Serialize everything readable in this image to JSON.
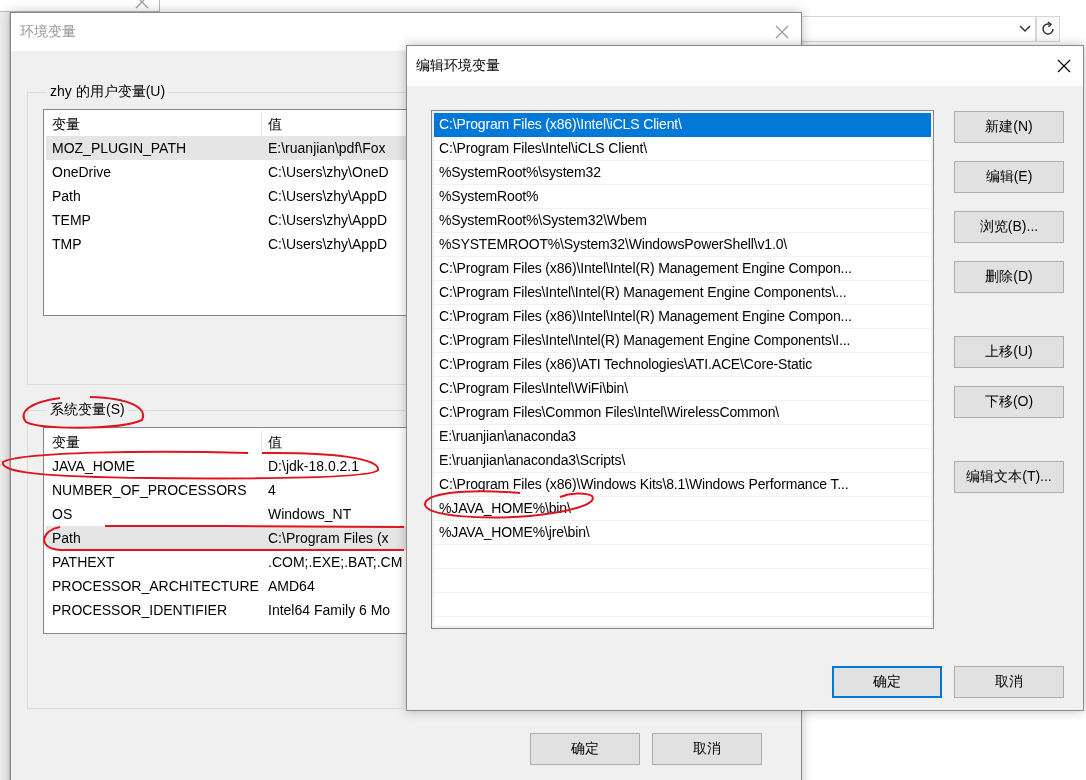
{
  "env_dialog": {
    "title": "环境变量",
    "user_group": {
      "title": "zhy 的用户变量(U)",
      "columns": [
        "变量",
        "值"
      ],
      "rows": [
        {
          "name": "MOZ_PLUGIN_PATH",
          "value": "E:\\ruanjian\\pdf\\Fox",
          "selected": true
        },
        {
          "name": "OneDrive",
          "value": "C:\\Users\\zhy\\OneD",
          "selected": false
        },
        {
          "name": "Path",
          "value": "C:\\Users\\zhy\\AppD",
          "selected": false
        },
        {
          "name": "TEMP",
          "value": "C:\\Users\\zhy\\AppD",
          "selected": false
        },
        {
          "name": "TMP",
          "value": "C:\\Users\\zhy\\AppD",
          "selected": false
        }
      ]
    },
    "system_group": {
      "title": "系统变量(S)",
      "columns": [
        "变量",
        "值"
      ],
      "rows": [
        {
          "name": "JAVA_HOME",
          "value": "D:\\jdk-18.0.2.1",
          "selected": false
        },
        {
          "name": "NUMBER_OF_PROCESSORS",
          "value": "4",
          "selected": false
        },
        {
          "name": "OS",
          "value": "Windows_NT",
          "selected": false
        },
        {
          "name": "Path",
          "value": "C:\\Program Files (x",
          "selected": true
        },
        {
          "name": "PATHEXT",
          "value": ".COM;.EXE;.BAT;.CM",
          "selected": false
        },
        {
          "name": "PROCESSOR_ARCHITECTURE",
          "value": "AMD64",
          "selected": false
        },
        {
          "name": "PROCESSOR_IDENTIFIER",
          "value": "Intel64 Family 6 Mo",
          "selected": false
        }
      ]
    },
    "buttons": [
      {
        "label": "确定",
        "default": false
      },
      {
        "label": "取消",
        "default": false
      }
    ]
  },
  "edit_dialog": {
    "title": "编辑环境变量",
    "items": [
      {
        "text": "C:\\Program Files (x86)\\Intel\\iCLS Client\\",
        "selected": true
      },
      {
        "text": "C:\\Program Files\\Intel\\iCLS Client\\",
        "selected": false
      },
      {
        "text": "%SystemRoot%\\system32",
        "selected": false
      },
      {
        "text": "%SystemRoot%",
        "selected": false
      },
      {
        "text": "%SystemRoot%\\System32\\Wbem",
        "selected": false
      },
      {
        "text": "%SYSTEMROOT%\\System32\\WindowsPowerShell\\v1.0\\",
        "selected": false
      },
      {
        "text": "C:\\Program Files (x86)\\Intel\\Intel(R) Management Engine Compon...",
        "selected": false
      },
      {
        "text": "C:\\Program Files\\Intel\\Intel(R) Management Engine Components\\...",
        "selected": false
      },
      {
        "text": "C:\\Program Files (x86)\\Intel\\Intel(R) Management Engine Compon...",
        "selected": false
      },
      {
        "text": "C:\\Program Files\\Intel\\Intel(R) Management Engine Components\\I...",
        "selected": false
      },
      {
        "text": "C:\\Program Files (x86)\\ATI Technologies\\ATI.ACE\\Core-Static",
        "selected": false
      },
      {
        "text": "C:\\Program Files\\Intel\\WiFi\\bin\\",
        "selected": false
      },
      {
        "text": "C:\\Program Files\\Common Files\\Intel\\WirelessCommon\\",
        "selected": false
      },
      {
        "text": "E:\\ruanjian\\anaconda3",
        "selected": false
      },
      {
        "text": "E:\\ruanjian\\anaconda3\\Scripts\\",
        "selected": false
      },
      {
        "text": "C:\\Program Files (x86)\\Windows Kits\\8.1\\Windows Performance T...",
        "selected": false
      },
      {
        "text": "%JAVA_HOME%\\bin\\",
        "selected": false
      },
      {
        "text": "%JAVA_HOME%\\jre\\bin\\",
        "selected": false
      }
    ],
    "side_button_groups": [
      [
        "新建(N)",
        "编辑(E)",
        "浏览(B)...",
        "删除(D)"
      ],
      [
        "上移(U)",
        "下移(O)"
      ],
      [
        "编辑文本(T)..."
      ]
    ],
    "buttons": [
      {
        "label": "确定",
        "default": true
      },
      {
        "label": "取消",
        "default": false
      }
    ]
  }
}
